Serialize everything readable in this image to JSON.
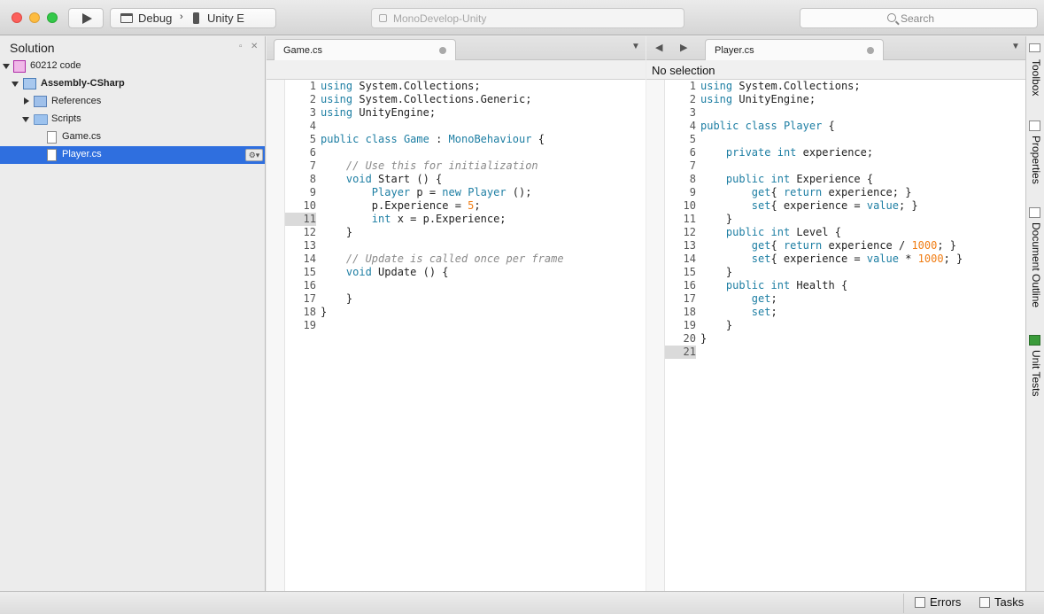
{
  "toolbar": {
    "config_label": "Debug",
    "device_label": "Unity E",
    "status_text": "MonoDevelop-Unity",
    "search_placeholder": "Search"
  },
  "solution_panel": {
    "title": "Solution",
    "items": [
      {
        "label": "60212 code",
        "icon": "solution-icon"
      },
      {
        "label": "Assembly-CSharp",
        "icon": "project-icon"
      },
      {
        "label": "References",
        "icon": "references-icon"
      },
      {
        "label": "Scripts",
        "icon": "folder-icon"
      },
      {
        "label": "Game.cs",
        "icon": "cs-file-icon"
      },
      {
        "label": "Player.cs",
        "icon": "cs-file-icon",
        "selected": true
      }
    ]
  },
  "left_editor": {
    "tab": "Game.cs",
    "current_line": 11,
    "lines": [
      "1",
      "2",
      "3",
      "4",
      "5",
      "6",
      "7",
      "8",
      "9",
      "10",
      "11",
      "12",
      "13",
      "14",
      "15",
      "16",
      "17",
      "18",
      "19"
    ]
  },
  "right_editor": {
    "tab": "Player.cs",
    "path_text": "No selection",
    "current_line": 21
  },
  "right_pads": {
    "toolbox": "Toolbox",
    "properties": "Properties",
    "document_outline": "Document Outline",
    "unit_tests": "Unit Tests"
  },
  "statusbar": {
    "errors": "Errors",
    "tasks": "Tasks"
  },
  "colors": {
    "keyword": "#1d7ea3",
    "comment": "#8b8b8b",
    "number": "#f07d14",
    "selection": "#2f6fdf"
  }
}
